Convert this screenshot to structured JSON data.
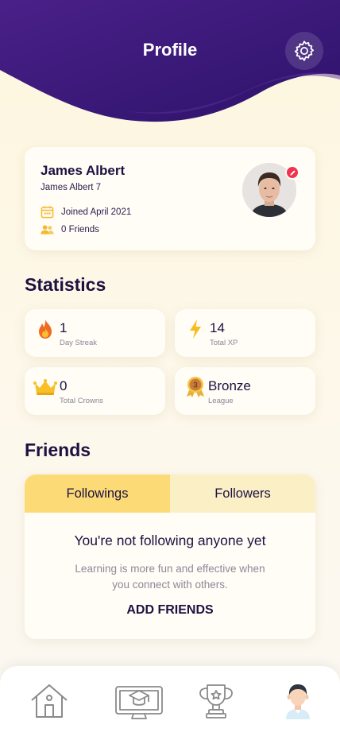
{
  "header": {
    "title": "Profile"
  },
  "profile": {
    "name": "James Albert",
    "username": "James Albert 7",
    "joined": "Joined April 2021",
    "friends": "0 Friends"
  },
  "statistics": {
    "title": "Statistics",
    "items": [
      {
        "value": "1",
        "label": "Day Streak",
        "icon": "fire-icon"
      },
      {
        "value": "14",
        "label": "Total XP",
        "icon": "lightning-icon"
      },
      {
        "value": "0",
        "label": "Total Crowns",
        "icon": "crown-icon"
      },
      {
        "value": "Bronze",
        "label": "League",
        "icon": "bronze-medal-icon"
      }
    ]
  },
  "friends": {
    "title": "Friends",
    "tabs": [
      {
        "label": "Followings",
        "active": true
      },
      {
        "label": "Followers",
        "active": false
      }
    ],
    "empty_title": "You're not following anyone yet",
    "empty_description": "Learning is more fun and effective when you connect with others.",
    "add_button": "ADD FRIENDS"
  },
  "medal_number": "3",
  "nav": [
    "home-icon",
    "learning-monitor-icon",
    "trophy-icon",
    "profile-avatar-icon"
  ],
  "colors": {
    "header_purple": "#3b1a7a",
    "accent_yellow": "#fcdb76",
    "inactive_tab": "#fbefc6",
    "edit_badge": "#f0334e",
    "text_dark": "#1c1140"
  }
}
